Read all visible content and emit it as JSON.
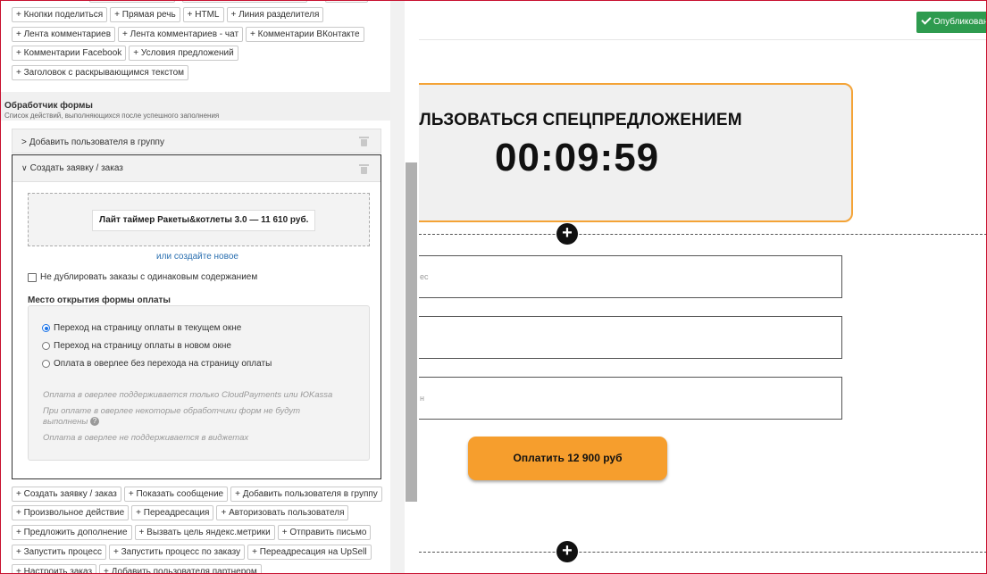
{
  "top_buttons": {
    "row1": [
      "+ Кнопки поделиться",
      "+ Прямая речь",
      "+ HTML",
      "+ Линия разделителя"
    ],
    "row2": [
      "+ Лента комментариев",
      "+ Лента комментариев - чат",
      "+ Комментарии ВКонтакте"
    ],
    "row3": [
      "+ Комментарии Facebook",
      "+ Условия предложений"
    ],
    "row4": [
      "+ Заголовок с раскрывающимся текстом"
    ]
  },
  "form_handler": {
    "title": "Обработчик формы",
    "subtitle": "Список действий, выполняющихся после успешного заполнения",
    "handler1": {
      "label": "Добавить пользователя в группу",
      "chevron": ">"
    },
    "handler2": {
      "label": "Создать заявку / заказ",
      "chevron": "∨",
      "product": "Лайт таймер Ракеты&котлеты 3.0 — 11 610 руб.",
      "create_link": "или создайте новое",
      "no_duplicate": "Не дублировать заказы с одинаковым содержанием",
      "payment_window_title": "Место открытия формы оплаты",
      "options": [
        {
          "label": "Переход на страницу оплаты в текущем окне",
          "checked": true
        },
        {
          "label": "Переход на страницу оплаты в новом окне",
          "checked": false
        },
        {
          "label": "Оплата в оверлее без перехода на страницу оплаты",
          "checked": false
        }
      ],
      "notes": [
        "Оплата в оверлее поддерживается только CloudPayments или ЮKassa",
        "При оплате в оверлее некоторые обработчики форм не будут выполнены",
        "Оплата в оверлее не поддерживается в виджетах"
      ],
      "help_glyph": "?"
    }
  },
  "action_buttons": {
    "row1": [
      "+ Создать заявку / заказ",
      "+ Показать сообщение",
      "+ Добавить пользователя в группу"
    ],
    "row2": [
      "+ Произвольное действие",
      "+ Переадресация",
      "+ Авторизовать пользователя"
    ],
    "row3": [
      "+ Предложить дополнение",
      "+ Вызвать цель яндекс.метрики",
      "+ Отправить письмо"
    ],
    "row4": [
      "+ Запустить процесс",
      "+ Запустить процесс по заказу",
      "+ Переадресация на UpSell"
    ],
    "row5": [
      "+ Настроить заказ",
      "+ Добавить пользователя партнером"
    ]
  },
  "canvas": {
    "publish_label": "Опубликовано",
    "promo_title": "ПОЛЬЗОВАТЬСЯ СПЕЦПРЕДЛОЖЕНИЕМ",
    "timer": "00:09:59",
    "field1_hint": "ес",
    "field3_hint": "н",
    "pay_button": "Оплатить 12 900 руб",
    "plus": "+"
  },
  "colors": {
    "publish_green": "#2e9b4f",
    "accent_orange": "#f69e2d",
    "card_border": "#f4a336",
    "link_blue": "#2a6fb0"
  }
}
